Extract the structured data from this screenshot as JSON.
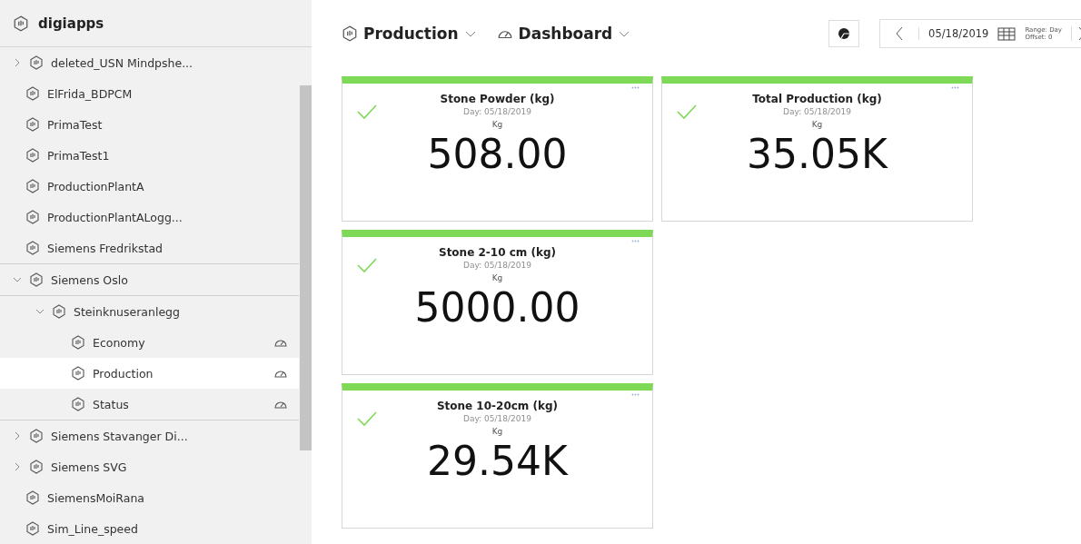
{
  "sidebar": {
    "title": "digiapps",
    "items": [
      {
        "label": "deleted_USN Mindpshe...",
        "expanded": false,
        "selected": false
      },
      {
        "label": "ElFrida_BDPCM",
        "selected": false
      },
      {
        "label": "PrimaTest",
        "selected": false
      },
      {
        "label": "PrimaTest1",
        "selected": false
      },
      {
        "label": "ProductionPlantA",
        "selected": false
      },
      {
        "label": "ProductionPlantALogg...",
        "selected": false
      },
      {
        "label": "Siemens Fredrikstad",
        "selected": false
      },
      {
        "label": "Siemens Oslo",
        "expanded": true,
        "selected": false,
        "children": [
          {
            "label": "Steinknuseranlegg",
            "expanded": true,
            "selected": false,
            "children": [
              {
                "label": "Economy",
                "kind": "dashboard",
                "selected": false
              },
              {
                "label": "Production",
                "kind": "dashboard",
                "selected": true
              },
              {
                "label": "Status",
                "kind": "dashboard",
                "selected": false
              }
            ]
          }
        ]
      },
      {
        "label": "Siemens Stavanger Di...",
        "expanded": false,
        "selected": false
      },
      {
        "label": "Siemens SVG",
        "expanded": false,
        "selected": false
      },
      {
        "label": "SiemensMoiRana",
        "selected": false
      },
      {
        "label": "Sim_Line_speed",
        "selected": false
      }
    ]
  },
  "header": {
    "asset": "Production",
    "view": "Dashboard",
    "date": "05/18/2019",
    "range": "Range: Day",
    "offset": "Offset: 0"
  },
  "tiles": [
    {
      "title": "Stone Powder (kg)",
      "date": "Day: 05/18/2019",
      "unit": "Kg",
      "value": "508.00",
      "ok": true
    },
    {
      "title": "Total Production (kg)",
      "date": "Day: 05/18/2019",
      "unit": "Kg",
      "value": "35.05K",
      "ok": true
    },
    {
      "title": "Stone 2-10 cm (kg)",
      "date": "Day: 05/18/2019",
      "unit": "Kg",
      "value": "5000.00",
      "ok": true
    },
    {
      "title": "Stone 10-20cm (kg)",
      "date": "Day: 05/18/2019",
      "unit": "Kg",
      "value": "29.54K",
      "ok": true
    }
  ]
}
